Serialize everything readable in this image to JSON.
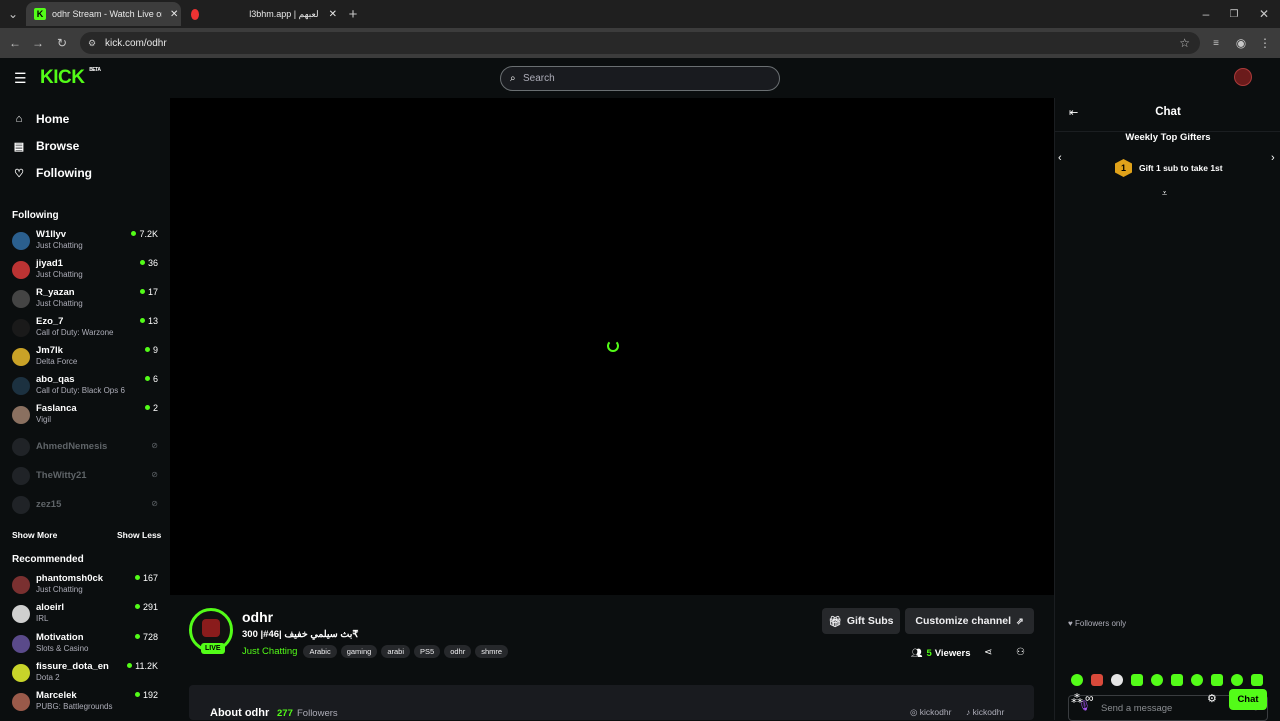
{
  "browser": {
    "tabs": [
      {
        "title": "odhr Stream - Watch Live on Ki",
        "active": true
      },
      {
        "title": "l3bhm.app | لعبهم",
        "active": false
      }
    ],
    "url": "kick.com/odhr"
  },
  "site": {
    "logo": "KICK",
    "logo_badge": "BETA",
    "search_placeholder": "Search"
  },
  "sidebar": {
    "nav": [
      {
        "label": "Home",
        "icon": "home-icon"
      },
      {
        "label": "Browse",
        "icon": "browse-icon"
      },
      {
        "label": "Following",
        "icon": "heart-icon"
      }
    ],
    "following_title": "Following",
    "following": [
      {
        "name": "W1llyv",
        "category": "Just Chatting",
        "viewers": "7.2K",
        "live": true
      },
      {
        "name": "jiyad1",
        "category": "Just Chatting",
        "viewers": "36",
        "live": true
      },
      {
        "name": "R_yazan",
        "category": "Just Chatting",
        "viewers": "17",
        "live": true
      },
      {
        "name": "Ezo_7",
        "category": "Call of Duty: Warzone",
        "viewers": "13",
        "live": true
      },
      {
        "name": "Jm7lk",
        "category": "Delta Force",
        "viewers": "9",
        "live": true
      },
      {
        "name": "abo_qas",
        "category": "Call of Duty: Black Ops 6",
        "viewers": "6",
        "live": true
      },
      {
        "name": "Faslanca",
        "category": "Vigil",
        "viewers": "2",
        "live": true
      },
      {
        "name": "AhmedNemesis",
        "category": "",
        "viewers": "",
        "live": false
      },
      {
        "name": "TheWitty21",
        "category": "",
        "viewers": "",
        "live": false
      },
      {
        "name": "zez15",
        "category": "",
        "viewers": "",
        "live": false
      }
    ],
    "show_more": "Show More",
    "show_less": "Show Less",
    "recommended_title": "Recommended",
    "recommended": [
      {
        "name": "phantomsh0ck",
        "category": "Just Chatting",
        "viewers": "167"
      },
      {
        "name": "aloeirl",
        "category": "IRL",
        "viewers": "291"
      },
      {
        "name": "Motivation",
        "category": "Slots & Casino",
        "viewers": "728"
      },
      {
        "name": "fissure_dota_en",
        "category": "Dota 2",
        "viewers": "11.2K"
      },
      {
        "name": "Marcelek",
        "category": "PUBG: Battlegrounds",
        "viewers": "192"
      }
    ]
  },
  "stream": {
    "channel": "odhr",
    "title": "بث سيلمي خفيف |46#| 300₹",
    "category": "Just Chatting",
    "live_badge": "LIVE",
    "tags": [
      "Arabic",
      "gaming",
      "arabi",
      "PS5",
      "odhr",
      "shmre"
    ],
    "gift_subs": "Gift Subs",
    "customize": "Customize channel",
    "viewers_count": "5",
    "viewers_label": "Viewers",
    "about_title": "About odhr",
    "followers_count": "277",
    "followers_label": "Followers",
    "social": [
      "kickodhr",
      "kickodhr"
    ]
  },
  "chat": {
    "title": "Chat",
    "gifters_title": "Weekly Top Gifters",
    "gifters_rank": "1",
    "gifters_text": "Gift 1 sub to take 1st",
    "followers_only": "Followers only",
    "placeholder": "Send a message",
    "send_label": "Chat",
    "accent": "#53fc18"
  }
}
